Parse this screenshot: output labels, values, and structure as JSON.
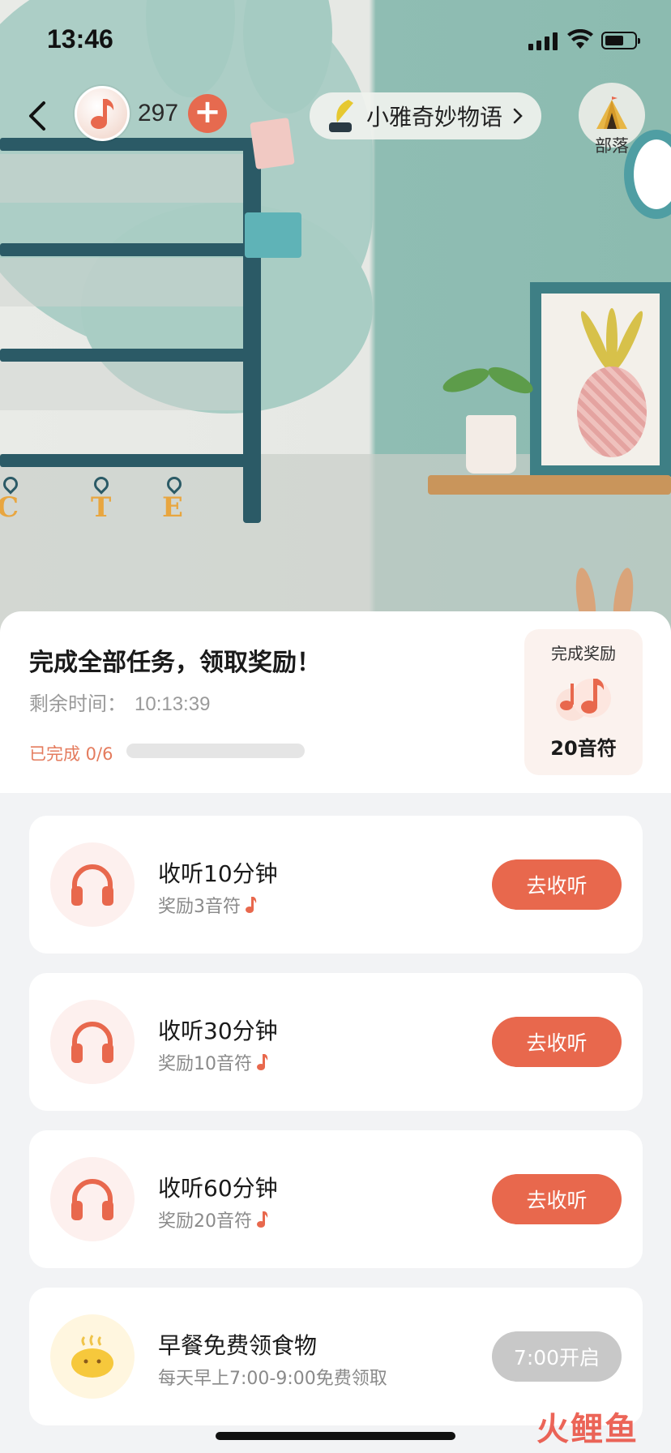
{
  "status_bar": {
    "time": "13:46"
  },
  "top_nav": {
    "coin_count": "297",
    "story_title": "小雅奇妙物语",
    "tribe_label": "部落"
  },
  "reward_header": {
    "title": "完成全部任务，领取奖励！",
    "remaining_label": "剩余时间：",
    "remaining_time": "10:13:39",
    "completed_label": "已完成 0/6",
    "progress_fraction": 0,
    "badge_title": "完成奖励",
    "badge_value": "20音符"
  },
  "tasks": [
    {
      "title": "收听10分钟",
      "subtitle": "奖励3音符",
      "button": "去收听",
      "icon": "headphones-icon",
      "enabled": true
    },
    {
      "title": "收听30分钟",
      "subtitle": "奖励10音符",
      "button": "去收听",
      "icon": "headphones-icon",
      "enabled": true
    },
    {
      "title": "收听60分钟",
      "subtitle": "奖励20音符",
      "button": "去收听",
      "icon": "headphones-icon",
      "enabled": true
    },
    {
      "title": "早餐免费领食物",
      "subtitle": "每天早上7:00-9:00免费领取",
      "button": "7:00开启",
      "icon": "bun-icon",
      "enabled": false
    }
  ],
  "watermark": "火鲤鱼",
  "colors": {
    "accent": "#e8684d",
    "disabled": "#c8c8c8",
    "progress_bg": "#e5e5e5"
  }
}
